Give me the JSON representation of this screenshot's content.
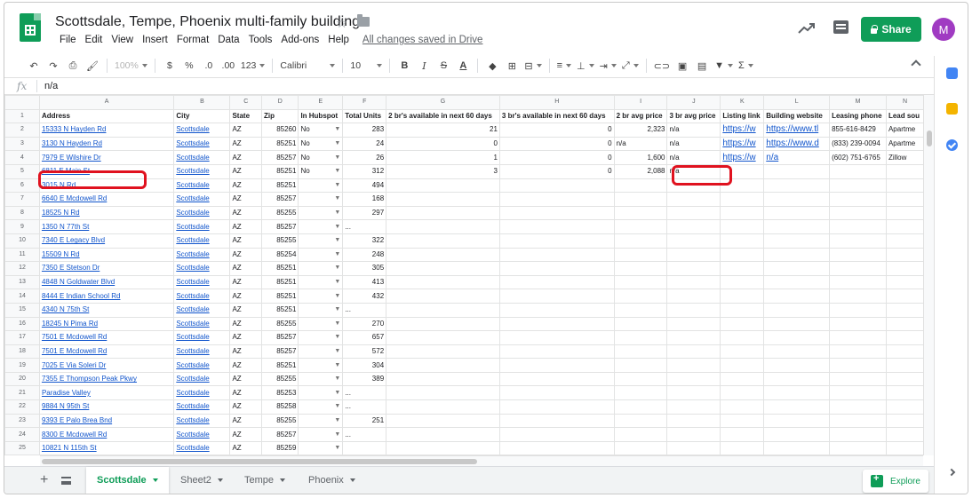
{
  "header": {
    "title": "Scottsdale, Tempe, Phoenix multi-family buildings",
    "menu": [
      "File",
      "Edit",
      "View",
      "Insert",
      "Format",
      "Data",
      "Tools",
      "Add-ons",
      "Help"
    ],
    "saved_status": "All changes saved in Drive",
    "share_label": "Share",
    "avatar_initial": "M"
  },
  "toolbar": {
    "zoom": "100%",
    "currency": "$",
    "percent": "%",
    "decimal_less": ".0",
    "decimal_more": ".00",
    "format_more": "123",
    "font": "Calibri",
    "font_size": "10",
    "bold": "B",
    "italic": "I",
    "strike": "S",
    "text_color": "A",
    "functions": "Σ"
  },
  "formula_bar": {
    "fx": "fx",
    "value": "n/a"
  },
  "columns": [
    "A",
    "B",
    "C",
    "D",
    "E",
    "F",
    "G",
    "H",
    "I",
    "J",
    "K",
    "L",
    "M",
    "N"
  ],
  "header_row": [
    "Address",
    "City",
    "State",
    "Zip",
    "In Hubspot",
    "Total Units",
    "2 br's available in next 60 days",
    "3 br's available in next 60 days",
    "2 br avg price",
    "3 br avg price",
    "Listing link",
    "Building website",
    "Leasing phone",
    "Lead sou"
  ],
  "rows": [
    {
      "n": "2",
      "address": "15333 N Hayden Rd",
      "city": "Scottsdale",
      "state": "AZ",
      "zip": "85260",
      "hubspot": "No",
      "units": "283",
      "br2": "21",
      "br3": "0",
      "price2": "2,323",
      "price3": "n/a",
      "listing": "https://w",
      "website": "https://www.tl",
      "phone": "855-616-8429",
      "lead": "Apartme"
    },
    {
      "n": "3",
      "address": "3130 N Hayden Rd",
      "city": "Scottsdale",
      "state": "AZ",
      "zip": "85251",
      "hubspot": "No",
      "units": "24",
      "br2": "0",
      "br3": "0",
      "price2": "n/a",
      "price3": "n/a",
      "listing": "https://w",
      "website": "https://www.d",
      "phone": "(833) 239-0094",
      "lead": "Apartme"
    },
    {
      "n": "4",
      "address": "7979 E Wilshire Dr",
      "city": "Scottsdale",
      "state": "AZ",
      "zip": "85257",
      "hubspot": "No",
      "units": "26",
      "br2": "1",
      "br3": "0",
      "price2": "1,600",
      "price3": "n/a",
      "listing": "https://w",
      "website": "n/a",
      "phone": "(602) 751-6765",
      "lead": "Zillow"
    },
    {
      "n": "5",
      "address": "6811 E Main St",
      "city": "Scottsdale",
      "state": "AZ",
      "zip": "85251",
      "hubspot": "No",
      "units": "312",
      "br2": "3",
      "br3": "0",
      "price2": "2,088",
      "price3": "n/a",
      "listing": "",
      "website": "",
      "phone": "",
      "lead": ""
    },
    {
      "n": "6",
      "address": "3015 N Rd",
      "city": "Scottsdale",
      "state": "AZ",
      "zip": "85251",
      "hubspot": "",
      "units": "494"
    },
    {
      "n": "7",
      "address": "6640 E Mcdowell Rd",
      "city": "Scottsdale",
      "state": "AZ",
      "zip": "85257",
      "hubspot": "",
      "units": "168"
    },
    {
      "n": "8",
      "address": "18525 N Rd",
      "city": "Scottsdale",
      "state": "AZ",
      "zip": "85255",
      "hubspot": "",
      "units": "297"
    },
    {
      "n": "9",
      "address": "1350 N 77th St",
      "city": "Scottsdale",
      "state": "AZ",
      "zip": "85257",
      "hubspot": "",
      "units": "..."
    },
    {
      "n": "10",
      "address": "7340 E Legacy Blvd",
      "city": "Scottsdale",
      "state": "AZ",
      "zip": "85255",
      "hubspot": "",
      "units": "322"
    },
    {
      "n": "11",
      "address": "15509 N Rd",
      "city": "Scottsdale",
      "state": "AZ",
      "zip": "85254",
      "hubspot": "",
      "units": "248"
    },
    {
      "n": "12",
      "address": "7350 E Stetson Dr",
      "city": "Scottsdale",
      "state": "AZ",
      "zip": "85251",
      "hubspot": "",
      "units": "305"
    },
    {
      "n": "13",
      "address": "4848 N Goldwater Blvd",
      "city": "Scottsdale",
      "state": "AZ",
      "zip": "85251",
      "hubspot": "",
      "units": "413"
    },
    {
      "n": "14",
      "address": "8444 E Indian School Rd",
      "city": "Scottsdale",
      "state": "AZ",
      "zip": "85251",
      "hubspot": "",
      "units": "432"
    },
    {
      "n": "15",
      "address": "4340 N 75th St",
      "city": "Scottsdale",
      "state": "AZ",
      "zip": "85251",
      "hubspot": "",
      "units": "..."
    },
    {
      "n": "16",
      "address": "18245 N Pima Rd",
      "city": "Scottsdale",
      "state": "AZ",
      "zip": "85255",
      "hubspot": "",
      "units": "270"
    },
    {
      "n": "17",
      "address": "7501 E Mcdowell Rd",
      "city": "Scottsdale",
      "state": "AZ",
      "zip": "85257",
      "hubspot": "",
      "units": "657"
    },
    {
      "n": "18",
      "address": "7501 E Mcdowell Rd",
      "city": "Scottsdale",
      "state": "AZ",
      "zip": "85257",
      "hubspot": "",
      "units": "572"
    },
    {
      "n": "19",
      "address": "7025 E Via Soleri Dr",
      "city": "Scottsdale",
      "state": "AZ",
      "zip": "85251",
      "hubspot": "",
      "units": "304"
    },
    {
      "n": "20",
      "address": "7355 E Thompson Peak Pkwy",
      "city": "Scottsdale",
      "state": "AZ",
      "zip": "85255",
      "hubspot": "",
      "units": "389"
    },
    {
      "n": "21",
      "address": "Paradise Valley",
      "city": "Scottsdale",
      "state": "AZ",
      "zip": "85253",
      "hubspot": "",
      "units": "..."
    },
    {
      "n": "22",
      "address": "9884 N 95th St",
      "city": "Scottsdale",
      "state": "AZ",
      "zip": "85258",
      "hubspot": "",
      "units": "..."
    },
    {
      "n": "23",
      "address": "9393 E Palo Brea Bnd",
      "city": "Scottsdale",
      "state": "AZ",
      "zip": "85255",
      "hubspot": "",
      "units": "251"
    },
    {
      "n": "24",
      "address": "8300 E Mcdowell Rd",
      "city": "Scottsdale",
      "state": "AZ",
      "zip": "85257",
      "hubspot": "",
      "units": "..."
    },
    {
      "n": "25",
      "address": "10821 N 115th St",
      "city": "Scottsdale",
      "state": "AZ",
      "zip": "85259",
      "hubspot": "",
      "units": ""
    }
  ],
  "tabs": [
    {
      "label": "Scottsdale",
      "active": true
    },
    {
      "label": "Sheet2",
      "active": false
    },
    {
      "label": "Tempe",
      "active": false
    },
    {
      "label": "Phoenix",
      "active": false
    }
  ],
  "explore_label": "Explore",
  "colors": {
    "brand_green": "#0f9d58",
    "link_blue": "#1155cc",
    "highlight_red": "#e0121f",
    "avatar": "#a03bc2"
  }
}
